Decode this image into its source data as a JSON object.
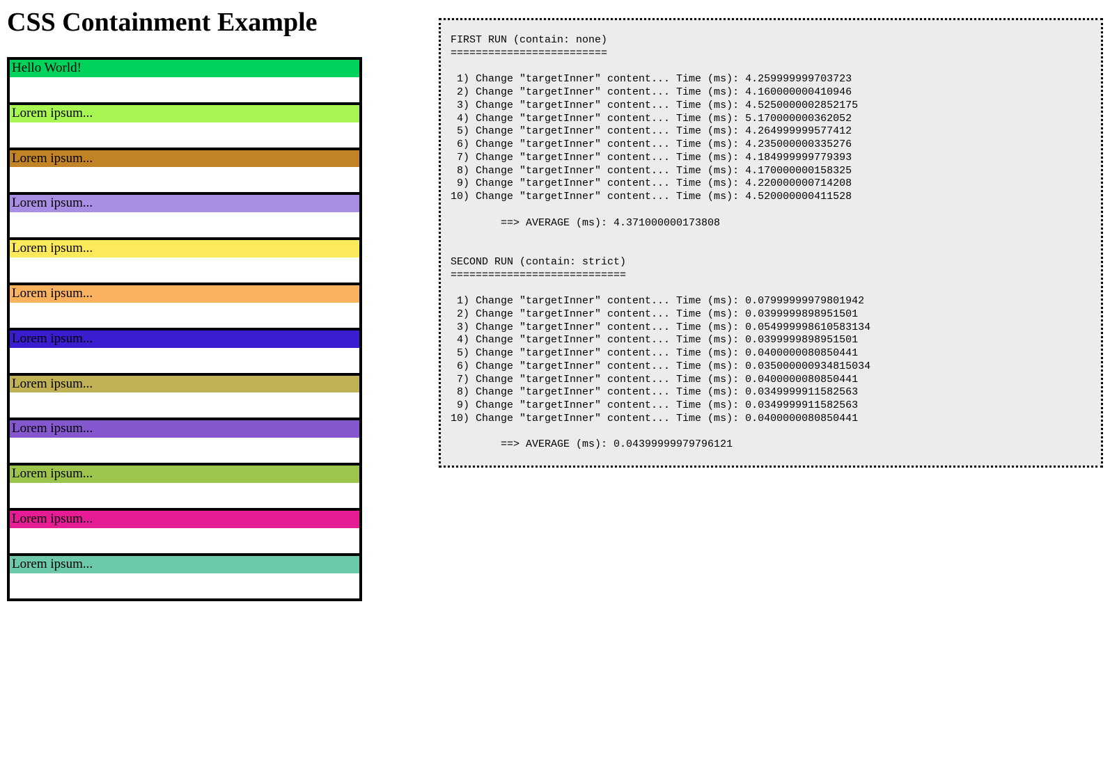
{
  "title": "CSS Containment Example",
  "boxes": [
    {
      "label": "Hello World!",
      "color": "#00d35b"
    },
    {
      "label": "Lorem ipsum...",
      "color": "#a7f651"
    },
    {
      "label": "Lorem ipsum...",
      "color": "#c28326"
    },
    {
      "label": "Lorem ipsum...",
      "color": "#a98ee3"
    },
    {
      "label": "Lorem ipsum...",
      "color": "#fdea5a"
    },
    {
      "label": "Lorem ipsum...",
      "color": "#fab25f"
    },
    {
      "label": "Lorem ipsum...",
      "color": "#3b1cce"
    },
    {
      "label": "Lorem ipsum...",
      "color": "#c0b154"
    },
    {
      "label": "Lorem ipsum...",
      "color": "#8557ce"
    },
    {
      "label": "Lorem ipsum...",
      "color": "#9dc44c"
    },
    {
      "label": "Lorem ipsum...",
      "color": "#e61c95"
    },
    {
      "label": "Lorem ipsum...",
      "color": "#6dc9ab"
    }
  ],
  "output": {
    "run1_title": "FIRST RUN (contain: none)",
    "run1_sep": "=========================",
    "run1_lines": [
      " 1) Change \"targetInner\" content... Time (ms): 4.259999999703723",
      " 2) Change \"targetInner\" content... Time (ms): 4.160000000410946",
      " 3) Change \"targetInner\" content... Time (ms): 4.5250000002852175",
      " 4) Change \"targetInner\" content... Time (ms): 5.170000000362052",
      " 5) Change \"targetInner\" content... Time (ms): 4.264999999577412",
      " 6) Change \"targetInner\" content... Time (ms): 4.235000000335276",
      " 7) Change \"targetInner\" content... Time (ms): 4.184999999779393",
      " 8) Change \"targetInner\" content... Time (ms): 4.170000000158325",
      " 9) Change \"targetInner\" content... Time (ms): 4.220000000714208",
      "10) Change \"targetInner\" content... Time (ms): 4.520000000411528"
    ],
    "run1_avg": "        ==> AVERAGE (ms): 4.371000000173808",
    "run2_title": "SECOND RUN (contain: strict)",
    "run2_sep": "============================",
    "run2_lines": [
      " 1) Change \"targetInner\" content... Time (ms): 0.07999999979801942",
      " 2) Change \"targetInner\" content... Time (ms): 0.0399999898951501",
      " 3) Change \"targetInner\" content... Time (ms): 0.054999998610583134",
      " 4) Change \"targetInner\" content... Time (ms): 0.0399999898951501",
      " 5) Change \"targetInner\" content... Time (ms): 0.0400000080850441",
      " 6) Change \"targetInner\" content... Time (ms): 0.035000000934815034",
      " 7) Change \"targetInner\" content... Time (ms): 0.0400000080850441",
      " 8) Change \"targetInner\" content... Time (ms): 0.0349999911582563",
      " 9) Change \"targetInner\" content... Time (ms): 0.0349999911582563",
      "10) Change \"targetInner\" content... Time (ms): 0.0400000080850441"
    ],
    "run2_avg": "        ==> AVERAGE (ms): 0.04399999979796121"
  }
}
